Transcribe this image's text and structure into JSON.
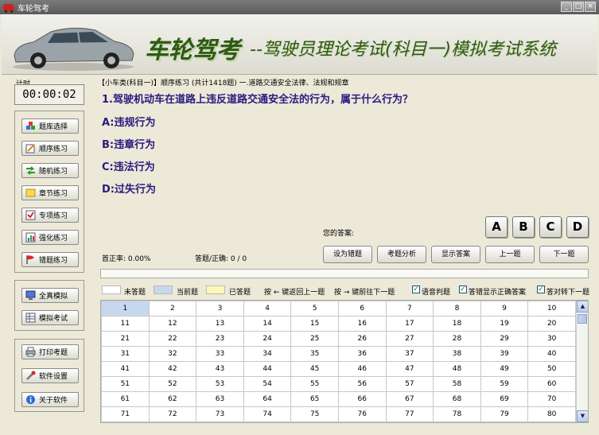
{
  "window": {
    "title": "车轮驾考"
  },
  "banner": {
    "brand": "车轮驾考",
    "subtitle": "--驾驶员理论考试(科目一)模拟考试系统"
  },
  "timer": {
    "label": "计时",
    "value": "00:00:02"
  },
  "menu": {
    "group1": [
      {
        "label": "题库选择",
        "icon": "cubes-icon"
      },
      {
        "label": "顺序练习",
        "icon": "pencil-icon"
      },
      {
        "label": "随机练习",
        "icon": "shuffle-icon"
      },
      {
        "label": "章节练习",
        "icon": "note-icon"
      },
      {
        "label": "专项练习",
        "icon": "check-icon"
      },
      {
        "label": "强化练习",
        "icon": "bars-icon"
      },
      {
        "label": "错题练习",
        "icon": "flag-icon"
      }
    ],
    "group2": [
      {
        "label": "全真模拟",
        "icon": "monitor-icon"
      },
      {
        "label": "模拟考试",
        "icon": "table-icon"
      }
    ],
    "group3": [
      {
        "label": "打印考题",
        "icon": "printer-icon"
      },
      {
        "label": "软件设置",
        "icon": "tools-icon"
      },
      {
        "label": "关于软件",
        "icon": "info-icon"
      }
    ]
  },
  "breadcrumb": "【小车类(科目一)】顺序练习 (共计1418题) 一.道路交通安全法律、法规和规章",
  "question": {
    "text": "1.驾驶机动车在道路上违反道路交通安全法的行为，属于什么行为？",
    "options": [
      "A:违规行为",
      "B:违章行为",
      "C:违法行为",
      "D:过失行为"
    ]
  },
  "answer": {
    "label": "您的答案:",
    "choices": [
      "A",
      "B",
      "C",
      "D"
    ]
  },
  "stats": {
    "accuracy": "首正率: 0.00%",
    "answered": "答题/正确: 0 / 0"
  },
  "actions": {
    "wrong_book": "设为错题",
    "analysis": "考题分析",
    "show_answer": "显示答案",
    "prev": "上一题",
    "next": "下一题"
  },
  "progress": {
    "fraction": 0.0
  },
  "legend": {
    "unanswered": "未答题",
    "current": "当前题",
    "answered": "已答题",
    "key_prev": "按 ← 键返回上一题",
    "key_next": "按 → 键前往下一题"
  },
  "options": {
    "voice": "语音判题",
    "show_correct": "答错显示正确答案",
    "auto_next": "答对转下一题"
  },
  "colors": {
    "unanswered": "#ffffff",
    "current": "#c6d8ee",
    "answered": "#fff7b8",
    "question_text": "#2a1a80",
    "brand": "#2e5a12"
  },
  "grid": {
    "current": 1,
    "rows": [
      [
        "1",
        "2",
        "3",
        "4",
        "5",
        "6",
        "7",
        "8",
        "9",
        "10"
      ],
      [
        "11",
        "12",
        "13",
        "14",
        "15",
        "16",
        "17",
        "18",
        "19",
        "20"
      ],
      [
        "21",
        "22",
        "23",
        "24",
        "25",
        "26",
        "27",
        "28",
        "29",
        "30"
      ],
      [
        "31",
        "32",
        "33",
        "34",
        "35",
        "36",
        "37",
        "38",
        "39",
        "40"
      ],
      [
        "41",
        "42",
        "43",
        "44",
        "45",
        "46",
        "47",
        "48",
        "49",
        "50"
      ],
      [
        "51",
        "52",
        "53",
        "54",
        "55",
        "56",
        "57",
        "58",
        "59",
        "60"
      ],
      [
        "61",
        "62",
        "63",
        "64",
        "65",
        "66",
        "67",
        "68",
        "69",
        "70"
      ],
      [
        "71",
        "72",
        "73",
        "74",
        "75",
        "76",
        "77",
        "78",
        "79",
        "80"
      ]
    ]
  }
}
